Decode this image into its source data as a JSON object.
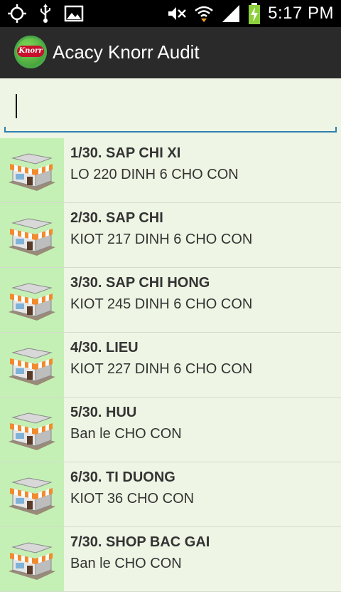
{
  "status_bar": {
    "time": "5:17 PM",
    "icons": [
      "gps-icon",
      "usb-icon",
      "image-icon",
      "mute-icon",
      "wifi-icon",
      "signal-icon",
      "battery-charging-icon"
    ]
  },
  "action_bar": {
    "title": "Acacy Knorr Audit",
    "logo_text": "Knorr"
  },
  "search": {
    "value": "",
    "placeholder": ""
  },
  "stores": [
    {
      "name": "1/30. SAP CHI XI",
      "address": "LO 220 DINH 6 CHO CON"
    },
    {
      "name": "2/30. SAP CHI",
      "address": "KIOT 217 DINH 6 CHO CON"
    },
    {
      "name": "3/30. SAP CHI HONG",
      "address": "KIOT 245 DINH 6 CHO CON"
    },
    {
      "name": "4/30. LIEU",
      "address": "KIOT 227 DINH 6 CHO CON"
    },
    {
      "name": "5/30. HUU",
      "address": "Ban le CHO CON"
    },
    {
      "name": "6/30. TI DUONG",
      "address": "KIOT 36 CHO CON"
    },
    {
      "name": "7/30. SHOP BAC GAI",
      "address": "Ban le CHO CON"
    }
  ],
  "colors": {
    "background": "#eef5e4",
    "thumb_background": "#c4f0b6",
    "action_bar": "#2a2a2a",
    "search_underline": "#2e7fb0"
  }
}
